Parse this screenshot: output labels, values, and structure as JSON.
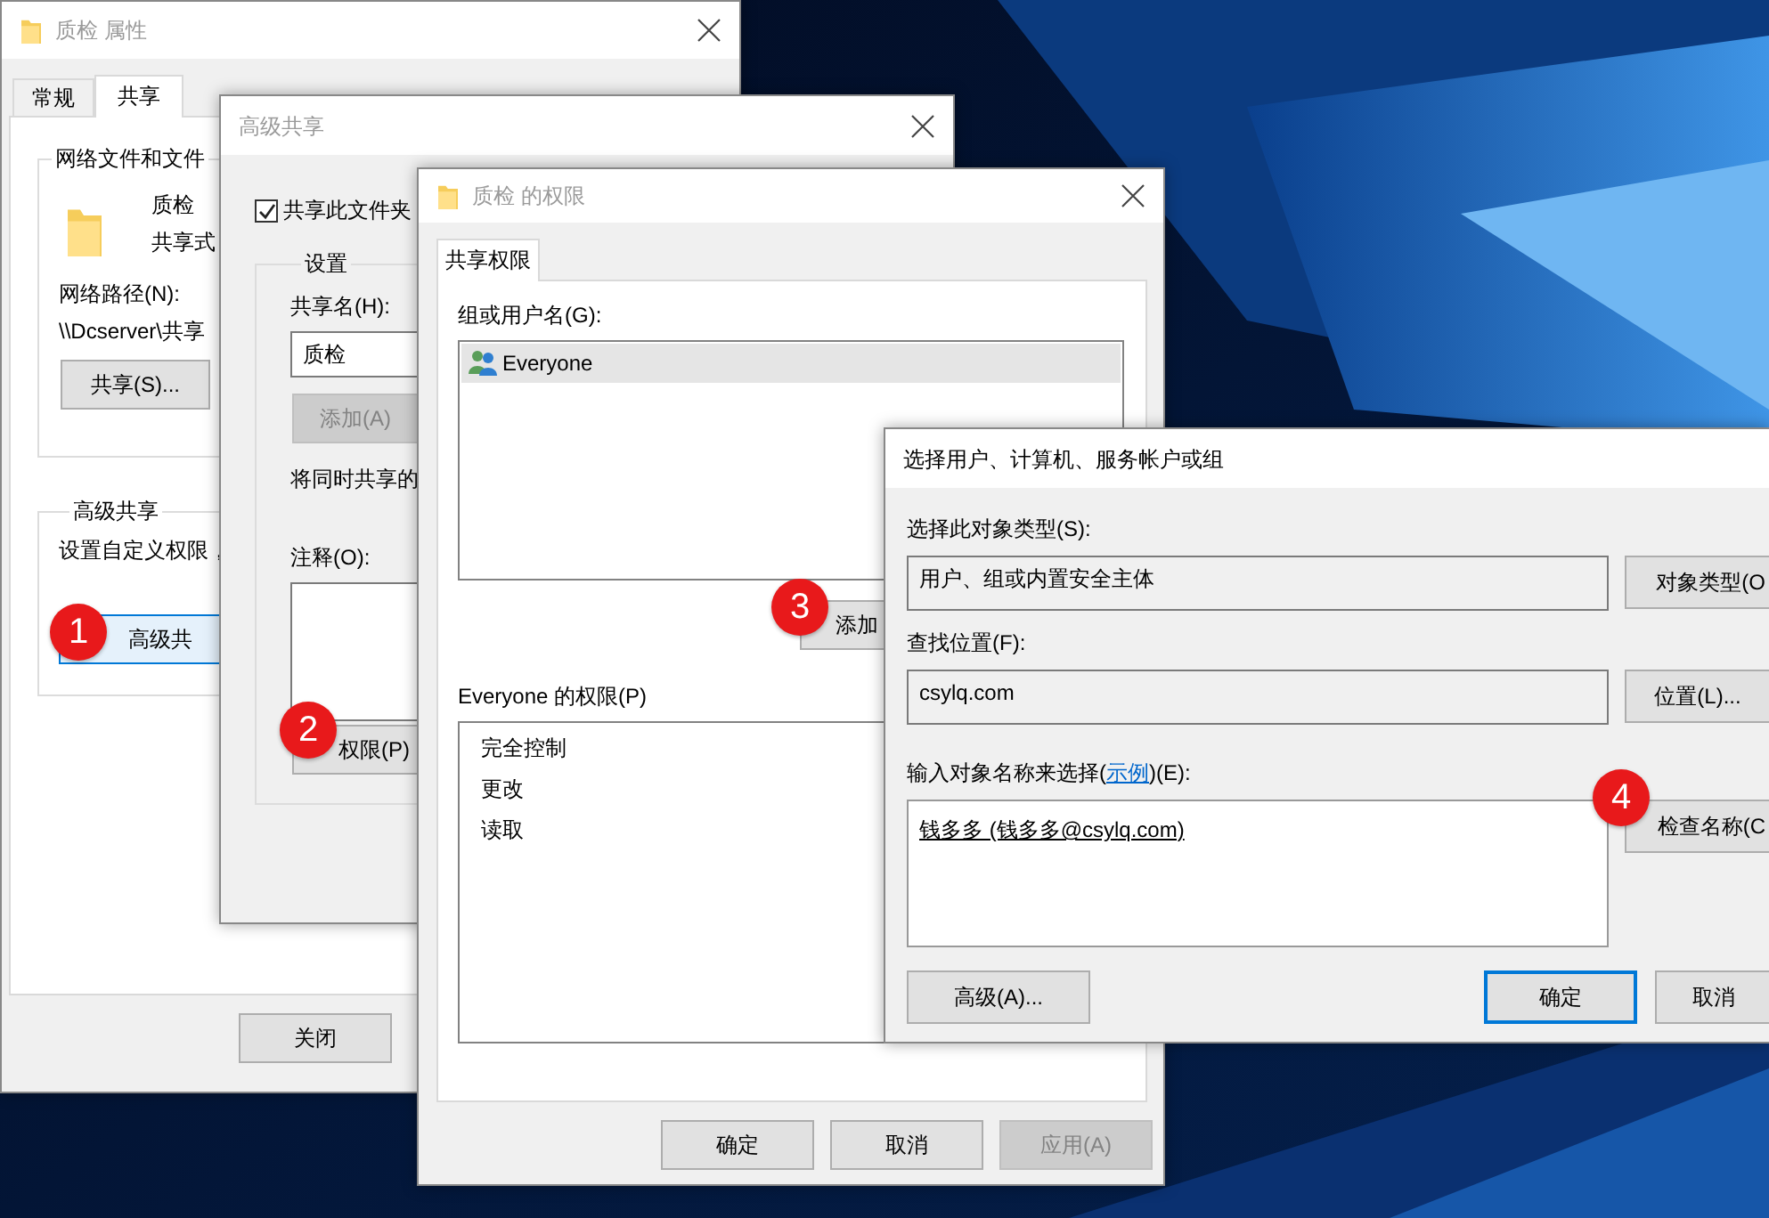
{
  "properties_window": {
    "title": "质检 属性",
    "active": false,
    "tabs": [
      {
        "label": "常规",
        "selected": false
      },
      {
        "label": "共享",
        "selected": true
      }
    ],
    "network_group": {
      "title": "网络文件和文件",
      "folder_name": "质检",
      "folder_status": "共享式",
      "path_label": "网络路径(N):",
      "path": "\\\\Dcserver\\共享",
      "share_button": "共享(S)..."
    },
    "advanced_group": {
      "title": "高级共享",
      "description": "设置自定义权限，",
      "button": {
        "label": "高级共",
        "badge": "1"
      }
    },
    "buttons": [
      "关闭"
    ]
  },
  "advanced_sharing_window": {
    "title": "高级共享",
    "active": false,
    "share_checkbox": {
      "label": "共享此文件夹",
      "checked": true
    },
    "settings_group": {
      "title": "设置",
      "share_name_label": "共享名(H):",
      "share_name": "质检",
      "add_button": {
        "label": "添加(A)",
        "disabled": true
      },
      "limit_text": "将同时共享的",
      "comment_label": "注释(O):",
      "permissions_button": {
        "label": "权限(P)",
        "badge": "2"
      }
    }
  },
  "permissions_window": {
    "title": "质检 的权限",
    "active": false,
    "tabs": [
      {
        "label": "共享权限",
        "selected": true
      }
    ],
    "users_label": "组或用户名(G):",
    "users": [
      {
        "name": "Everyone",
        "selected": true
      }
    ],
    "add_button": {
      "label": "添加",
      "badge": "3"
    },
    "permissions_label": "Everyone 的权限(P)",
    "permissions": [
      "完全控制",
      "更改",
      "读取"
    ],
    "buttons": [
      {
        "label": "确定",
        "disabled": false
      },
      {
        "label": "取消",
        "disabled": false
      },
      {
        "label": "应用(A)",
        "disabled": true
      }
    ]
  },
  "select_users_window": {
    "title": "选择用户、计算机、服务帐户或组",
    "active": true,
    "object_type_label": "选择此对象类型(S):",
    "object_type": "用户、组或内置安全主体",
    "object_type_button": "对象类型(O",
    "location_label": "查找位置(F):",
    "location": "csylq.com",
    "location_button": "位置(L)...",
    "names_label": {
      "before": "输入对象名称来选择(",
      "link": "示例",
      "after": ")(E):"
    },
    "names_value": "钱多多 (钱多多@csylq.com)",
    "names_resolved": true,
    "check_names_button": {
      "label": "检查名称(C",
      "badge": "4"
    },
    "buttons": [
      {
        "label": "高级(A)...",
        "focused": false
      },
      {
        "label": "确定",
        "focused": true
      },
      {
        "label": "取消",
        "focused": false
      }
    ]
  }
}
